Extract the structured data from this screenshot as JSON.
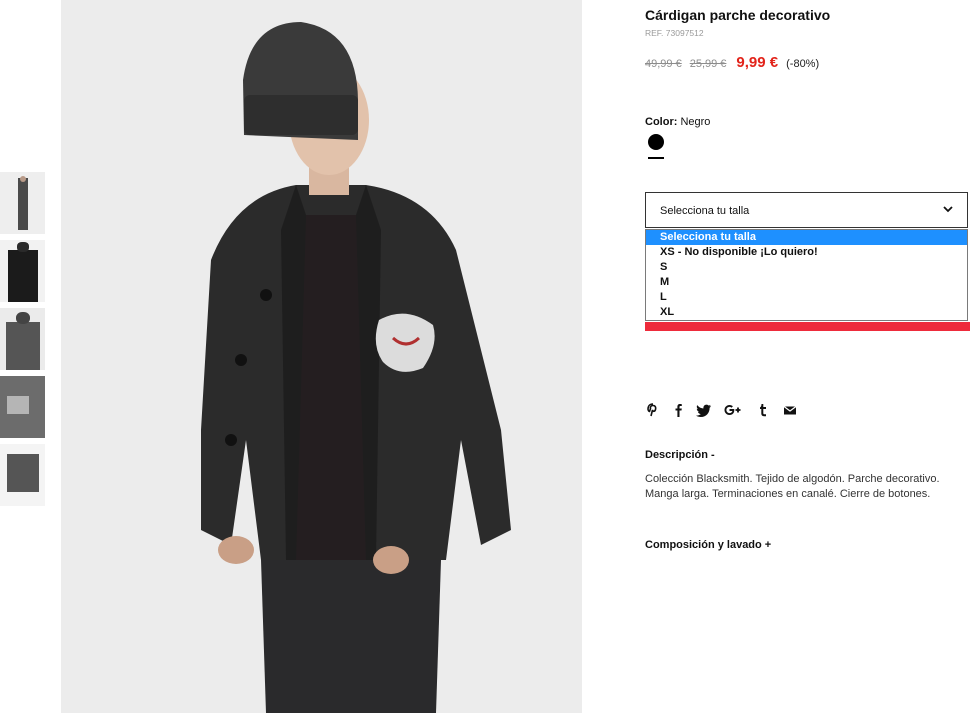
{
  "product": {
    "title": "Cárdigan parche decorativo",
    "ref": "REF. 73097512",
    "price_original": "49,99 €",
    "price_previous": "25,99 €",
    "price_current": "9,99 €",
    "discount": "(-80%)"
  },
  "color": {
    "label": "Color:",
    "value": "Negro",
    "swatch_hex": "#000000"
  },
  "size": {
    "placeholder": "Selecciona tu talla",
    "options": [
      "Selecciona tu talla",
      "XS - No disponible ¡Lo quiero!",
      "S",
      "M",
      "L",
      "XL"
    ],
    "selected_index": 0
  },
  "accent_colors": {
    "price_red": "#e2231a",
    "add_bar_red": "#ee2b3b",
    "selected_option_blue": "#1e90ff"
  },
  "share_icons": [
    "pinterest-icon",
    "facebook-icon",
    "twitter-icon",
    "google-plus-icon",
    "tumblr-icon",
    "email-icon"
  ],
  "description": {
    "heading": "Descripción -",
    "text": "Colección Blacksmith. Tejido de algodón. Parche decorativo. Manga larga. Terminaciones en canalé. Cierre de botones."
  },
  "composition": {
    "heading": "Composición y lavado +"
  }
}
